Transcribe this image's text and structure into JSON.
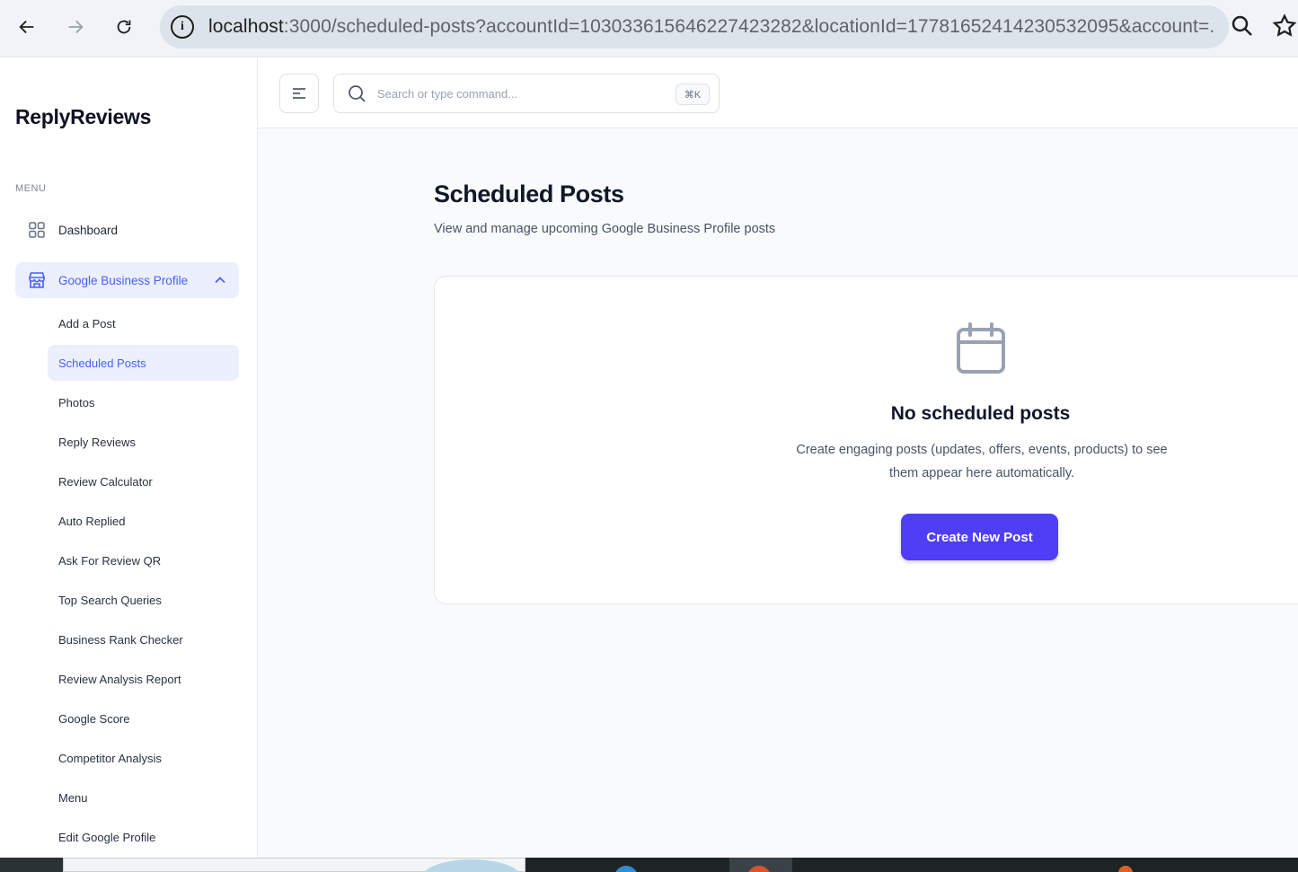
{
  "browser": {
    "url_host": "localhost",
    "url_path": ":3000/scheduled-posts?accountId=103033615646227423282&locationId=17781652414230532095&account=..."
  },
  "sidebar": {
    "brand": "ReplyReviews",
    "menu_label": "MENU",
    "items": [
      {
        "label": "Dashboard",
        "icon": "grid-icon"
      },
      {
        "label": "Google Business Profile",
        "icon": "storefront-icon",
        "expanded": true
      }
    ],
    "sub_items": [
      {
        "label": "Add a Post"
      },
      {
        "label": "Scheduled Posts",
        "active": true
      },
      {
        "label": "Photos"
      },
      {
        "label": "Reply Reviews"
      },
      {
        "label": "Review Calculator"
      },
      {
        "label": "Auto Replied"
      },
      {
        "label": "Ask For Review QR"
      },
      {
        "label": "Top Search Queries"
      },
      {
        "label": "Business Rank Checker"
      },
      {
        "label": "Review Analysis Report"
      },
      {
        "label": "Google Score"
      },
      {
        "label": "Competitor Analysis"
      },
      {
        "label": "Menu"
      },
      {
        "label": "Edit Google Profile"
      }
    ]
  },
  "header": {
    "search_placeholder": "Search or type command...",
    "shortcut": "⌘K"
  },
  "main": {
    "title": "Scheduled Posts",
    "subtitle": "View and manage upcoming Google Business Profile posts",
    "empty": {
      "icon": "calendar-icon",
      "title": "No scheduled posts",
      "description": "Create engaging posts (updates, offers, events, products) to see them appear here automatically.",
      "button": "Create New Post"
    }
  },
  "colors": {
    "accent": "#465fff",
    "button": "#4f3ef5",
    "active_bg": "#ecf0fe"
  }
}
